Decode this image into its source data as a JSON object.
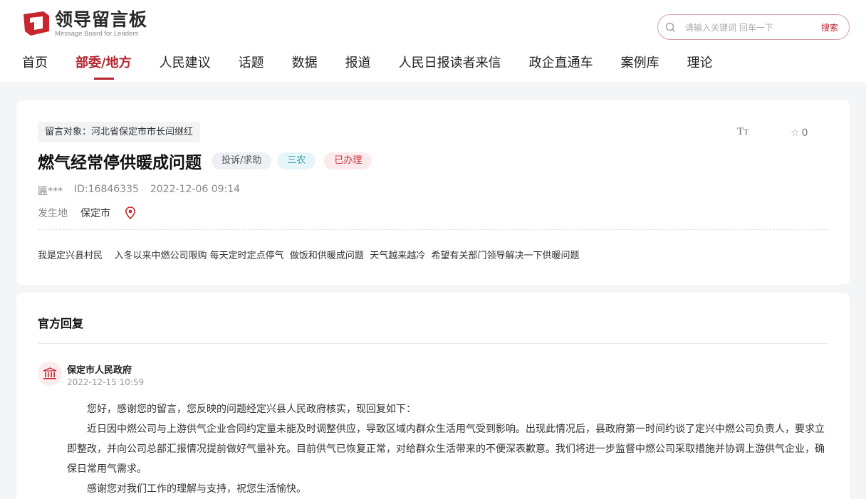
{
  "header": {
    "logo_cn": "领导留言板",
    "logo_en": "Message Board for Leaders",
    "brand_color": "#b4252f",
    "search": {
      "placeholder": "请输入关键词 回车一下",
      "button_label": "搜索"
    },
    "nav": [
      "首页",
      "部委/地方",
      "人民建议",
      "话题",
      "数据",
      "报道",
      "人民日报读者来信",
      "政企直通车",
      "案例库",
      "理论"
    ],
    "nav_active": "部委/地方"
  },
  "message": {
    "target": "留言对象：河北省保定市市长闫继红",
    "font_tool": "TT",
    "favorite_count": "0",
    "title": "燃气经常停供暖成问题",
    "tags": {
      "type": "投诉/求助",
      "domain": "三农",
      "status": "已办理"
    },
    "author": "匾***",
    "id": "ID:16846335",
    "time": "2022-12-06 09:14",
    "place_label": "发生地",
    "place_value": "保定市",
    "content": "我是定兴县村民    入冬以来中燃公司限购 每天定时定点停气  做饭和供暖成问题  天气越来越冷  希望有关部门领导解决一下供暖问题"
  },
  "reply": {
    "section_title": "官方回复",
    "org_name": "保定市人民政府",
    "date": "2022-12-15 10:59",
    "paragraphs": [
      "您好，感谢您的留言，您反映的问题经定兴县人民政府核实，现回复如下：",
      "近日因中燃公司与上游供气企业合同约定量未能及时调整供应，导致区域内群众生活用气受到影响。出现此情况后，县政府第一时间约谈了定兴中燃公司负责人，要求立即整改，并向公司总部汇报情况提前做好气量补充。目前供气已恢复正常，对给群众生活带来的不便深表歉意。我们将进一步监督中燃公司采取措施并协调上游供气企业，确保日常用气需求。",
      "感谢您对我们工作的理解与支持，祝您生活愉快。"
    ]
  }
}
